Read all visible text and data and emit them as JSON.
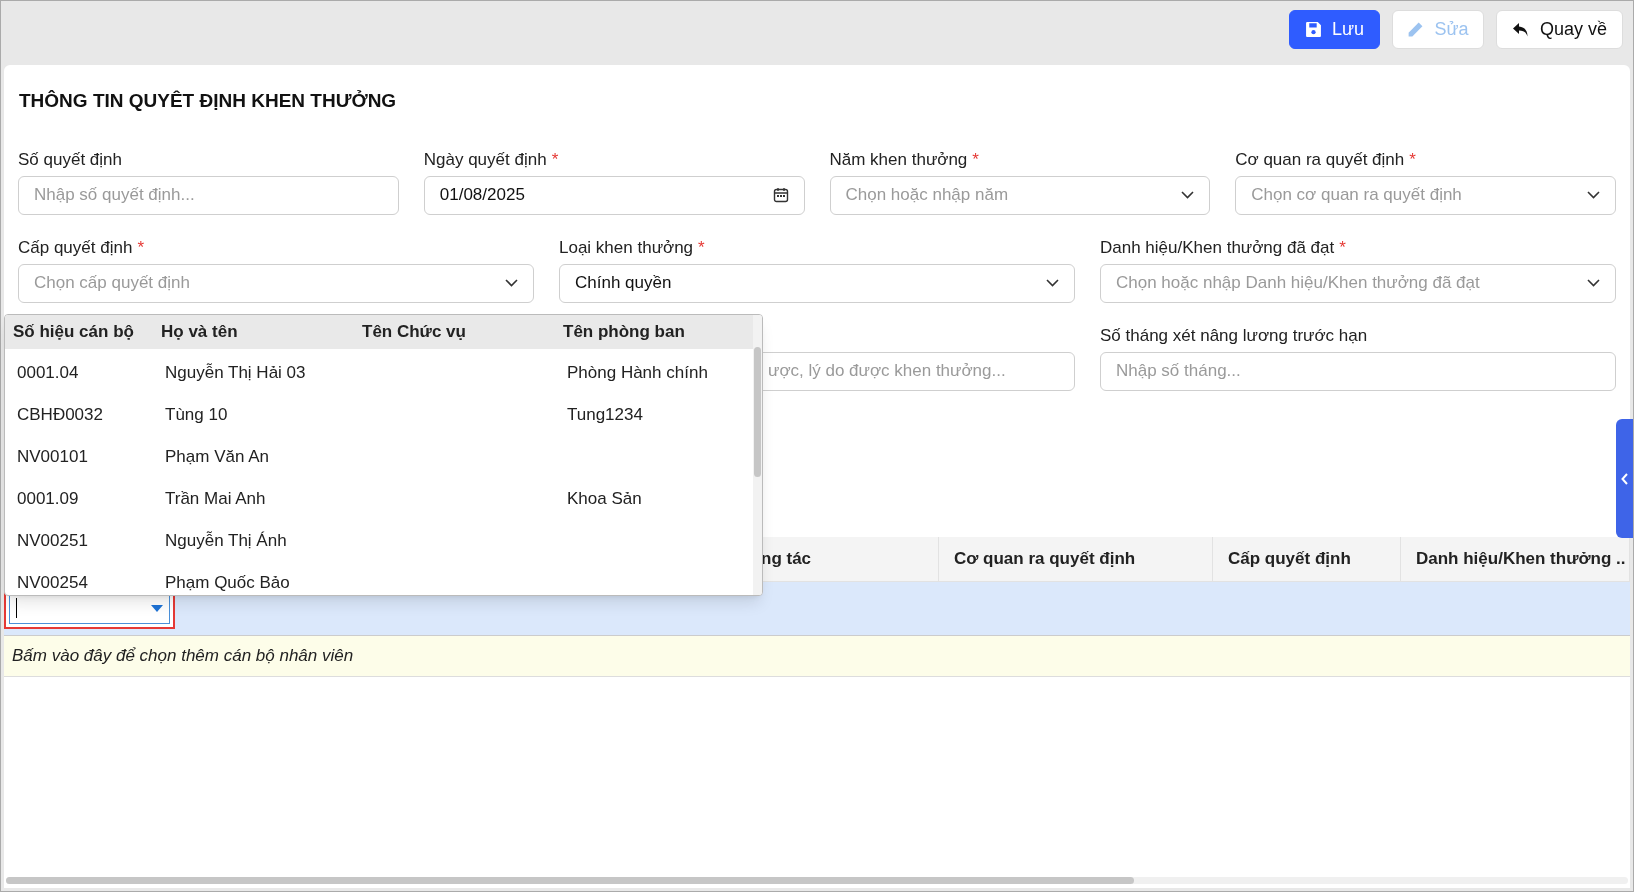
{
  "toolbar": [
    {
      "label": "Lưu",
      "kind": "save",
      "disabled": false
    },
    {
      "label": "Sửa",
      "kind": "edit",
      "disabled": true
    },
    {
      "label": "Quay về",
      "kind": "back",
      "disabled": false
    }
  ],
  "form": {
    "title": "THÔNG TIN QUYÊT ĐỊNH KHEN THƯỞNG",
    "rows": [
      {
        "fields": [
          {
            "label": "Số quyết định",
            "kind": "text",
            "placeholder": "Nhập số quyết định..."
          },
          {
            "label": "Ngày quyết định",
            "required_mark": "*",
            "kind": "date",
            "value": "01/08/2025"
          },
          {
            "label": "Năm khen thưởng",
            "required_mark": "*",
            "kind": "select",
            "placeholder": "Chọn hoặc nhập năm"
          },
          {
            "label": "Cơ quan ra quyết định",
            "required_mark": "*",
            "kind": "select",
            "placeholder": "Chọn cơ quan ra quyết định"
          }
        ]
      },
      {
        "fields": [
          {
            "label": "Cấp quyết định",
            "required_mark": "*",
            "kind": "select",
            "placeholder": "Chọn cấp quyết định"
          },
          {
            "label": "Loại khen thưởng",
            "required_mark": "*",
            "kind": "select",
            "value": "Chính quyền"
          },
          {
            "label": "Danh hiệu/Khen thưởng đã đạt",
            "required_mark": "*",
            "kind": "select",
            "placeholder": "Chọn hoặc nhập Danh hiệu/Khen thưởng đã đạt"
          }
        ]
      },
      {
        "fields": [
          {
            "kind": "covered",
            "placeholder": "ược, lý do được khen thưởng..."
          },
          {
            "label": "Số tháng xét nâng lương trước hạn",
            "kind": "text",
            "placeholder": "Nhập số tháng..."
          }
        ]
      }
    ]
  },
  "table": {
    "columns": [
      "ng tác",
      "Cơ quan ra quyết định",
      "Cấp quyết định",
      "Danh hiệu/Khen thưởng .."
    ],
    "add_row": "Bấm vào đây để chọn thêm cán bộ nhân viên"
  },
  "dropdown": {
    "columns": [
      "Số hiệu cán bộ",
      "Họ và tên",
      "Tên Chức vụ",
      "Tên phòng ban"
    ],
    "rows": [
      [
        "0001.04",
        "Nguyễn Thị Hải 03",
        "",
        "Phòng Hành chính"
      ],
      [
        "CBHĐ0032",
        "Tùng 10",
        "",
        "Tung1234"
      ],
      [
        "NV00101",
        "Phạm Văn An",
        "",
        ""
      ],
      [
        "0001.09",
        "Trần Mai Anh",
        "",
        "Khoa Sản"
      ],
      [
        "NV00251",
        "Nguyễn Thị Ánh",
        "",
        ""
      ],
      [
        "NV00254",
        "Phạm Quốc Bảo",
        "",
        ""
      ]
    ]
  }
}
